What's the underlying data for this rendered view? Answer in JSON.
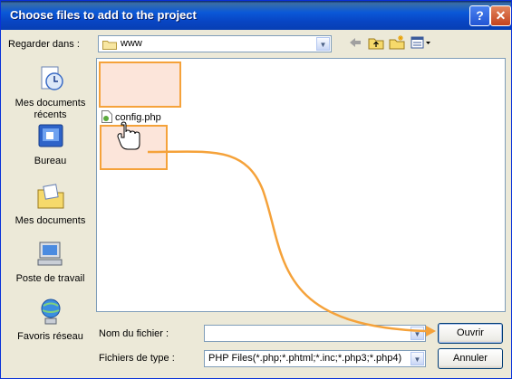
{
  "window": {
    "title": "Choose files to add to the project"
  },
  "titlebar": {
    "help_glyph": "?",
    "close_glyph": "✕"
  },
  "lookin": {
    "label": "Regarder dans :",
    "value": "www"
  },
  "toolbar": {
    "back_icon": "back-arrow-icon",
    "up_icon": "up-folder-icon",
    "newfolder_icon": "new-folder-icon",
    "views_icon": "views-menu-icon"
  },
  "places": [
    {
      "label": "Mes documents récents",
      "icon": "recent-documents-icon"
    },
    {
      "label": "Bureau",
      "icon": "desktop-icon"
    },
    {
      "label": "Mes documents",
      "icon": "my-documents-icon"
    },
    {
      "label": "Poste de travail",
      "icon": "my-computer-icon"
    },
    {
      "label": "Favoris réseau",
      "icon": "network-places-icon"
    }
  ],
  "files": [
    {
      "name": "config.php",
      "icon": "php-file-icon"
    }
  ],
  "filename": {
    "label": "Nom du fichier :",
    "value": ""
  },
  "filetype": {
    "label": "Fichiers de type :",
    "value": "PHP Files(*.php;*.phtml;*.inc;*.php3;*.php4)"
  },
  "buttons": {
    "open_label": "Ouvrir",
    "cancel_label": "Annuler"
  },
  "colors": {
    "highlight_border": "#F5A23A",
    "highlight_fill": "#FCE5DA",
    "titlebar": "#0A58D8"
  }
}
